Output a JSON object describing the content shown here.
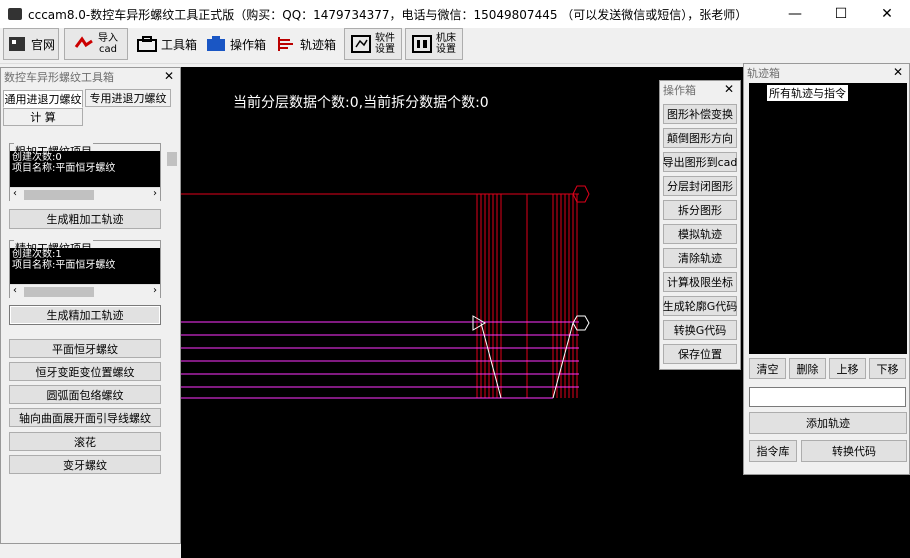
{
  "window": {
    "title": "cccam8.0-数控车异形螺纹工具正式版（购买：QQ：1479734377，电话与微信：15049807445 （可以发送微信或短信），张老师）",
    "minimize": "—",
    "maximize": "☐",
    "close": "✕"
  },
  "toolbar": {
    "official": "官网",
    "import_line1": "导入",
    "import_line2": "cad",
    "toolbox": "工具箱",
    "operation": "操作箱",
    "track": "轨迹箱",
    "software_settings": "软件\n设置",
    "machine_settings": "机床\n设置"
  },
  "canvas": {
    "info": "当前分层数据个数:0,当前拆分数据个数:0"
  },
  "toolbox_panel": {
    "title": "数控车异形螺纹工具箱",
    "close": "✕",
    "tabs": [
      "通用进退刀螺纹",
      "专用进退刀螺纹",
      "计  算"
    ],
    "rough": {
      "label": "粗加工螺纹项目",
      "text": "创建次数:0\n项目名称:平面恒牙螺纹",
      "button": "生成粗加工轨迹"
    },
    "finish": {
      "label": "精加工螺纹项目",
      "text": "创建次数:1\n项目名称:平面恒牙螺纹",
      "button": "生成精加工轨迹"
    },
    "types": [
      "平面恒牙螺纹",
      "恒牙变距变位置螺纹",
      "圆弧面包络螺纹",
      "轴向曲面展开面引导线螺纹",
      "滚花",
      "变牙螺纹"
    ]
  },
  "ops_panel": {
    "title": "操作箱",
    "close": "✕",
    "buttons": [
      "图形补偿变换",
      "颠倒图形方向",
      "导出图形到cad",
      "分层封闭图形",
      "拆分图形",
      "模拟轨迹",
      "清除轨迹",
      "计算极限坐标",
      "生成轮廓G代码",
      "转换G代码",
      "保存位置"
    ]
  },
  "track_panel": {
    "title": "轨迹箱",
    "close": "✕",
    "item": "所有轨迹与指令",
    "clear": "清空",
    "delete": "删除",
    "up": "上移",
    "down": "下移",
    "add": "添加轨迹",
    "library": "指令库",
    "convert": "转换代码"
  },
  "colors": {
    "red": "#ff0000",
    "magenta": "#ff33ff",
    "canvas": "#000000"
  }
}
